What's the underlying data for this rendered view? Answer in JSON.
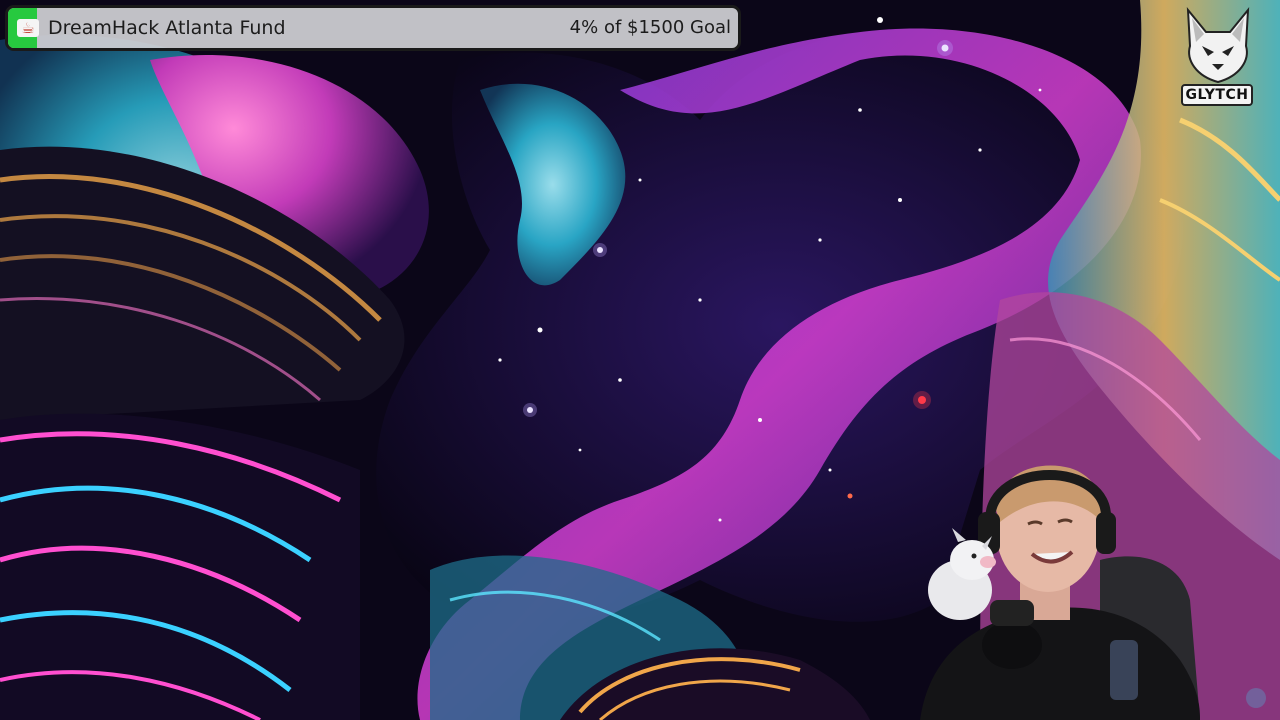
{
  "goal_widget": {
    "title": "DreamHack Atlanta Fund",
    "progress_text": "4% of $1500 Goal",
    "progress_percent": 4,
    "icon": "ko-fi-cup-icon",
    "fill_color": "#27c93f"
  },
  "branding": {
    "logo_text": "GLYTCH",
    "logo_icon": "fox-mascot-icon"
  },
  "webcam": {
    "description_icon": "streamer-webcam"
  },
  "colors": {
    "nebula_magenta": "#e23bd6",
    "nebula_cyan": "#35c8e0",
    "nebula_purple": "#5a2ea6",
    "nebula_orange": "#f0a64a"
  }
}
